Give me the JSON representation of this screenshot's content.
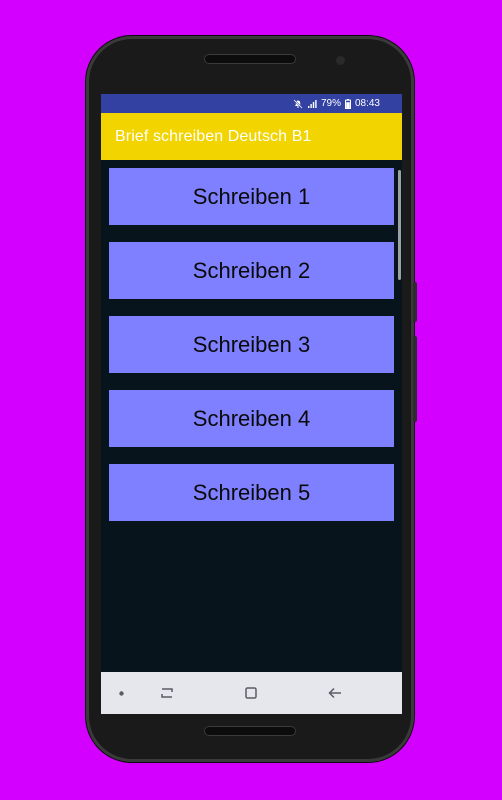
{
  "status_bar": {
    "mute_icon": "mute-icon",
    "signal_icon": "signal-icon",
    "battery_percent": "79%",
    "battery_icon": "battery-icon",
    "time": "08:43"
  },
  "app_bar": {
    "title": "Brief schreiben Deutsch B1"
  },
  "buttons": [
    {
      "label": "Schreiben 1"
    },
    {
      "label": "Schreiben 2"
    },
    {
      "label": "Schreiben 3"
    },
    {
      "label": "Schreiben 4"
    },
    {
      "label": "Schreiben 5"
    }
  ],
  "nav_bar": {
    "dot_icon": "dot-icon",
    "recents_icon": "swap-icon",
    "home_icon": "square-home-icon",
    "back_icon": "back-arrow-icon"
  },
  "colors": {
    "background": "#d400ff",
    "status_bar": "#3341a3",
    "app_bar": "#f2d400",
    "button": "#7f80ff",
    "screen": "#08141b",
    "nav_bar": "#e6e7ec"
  }
}
